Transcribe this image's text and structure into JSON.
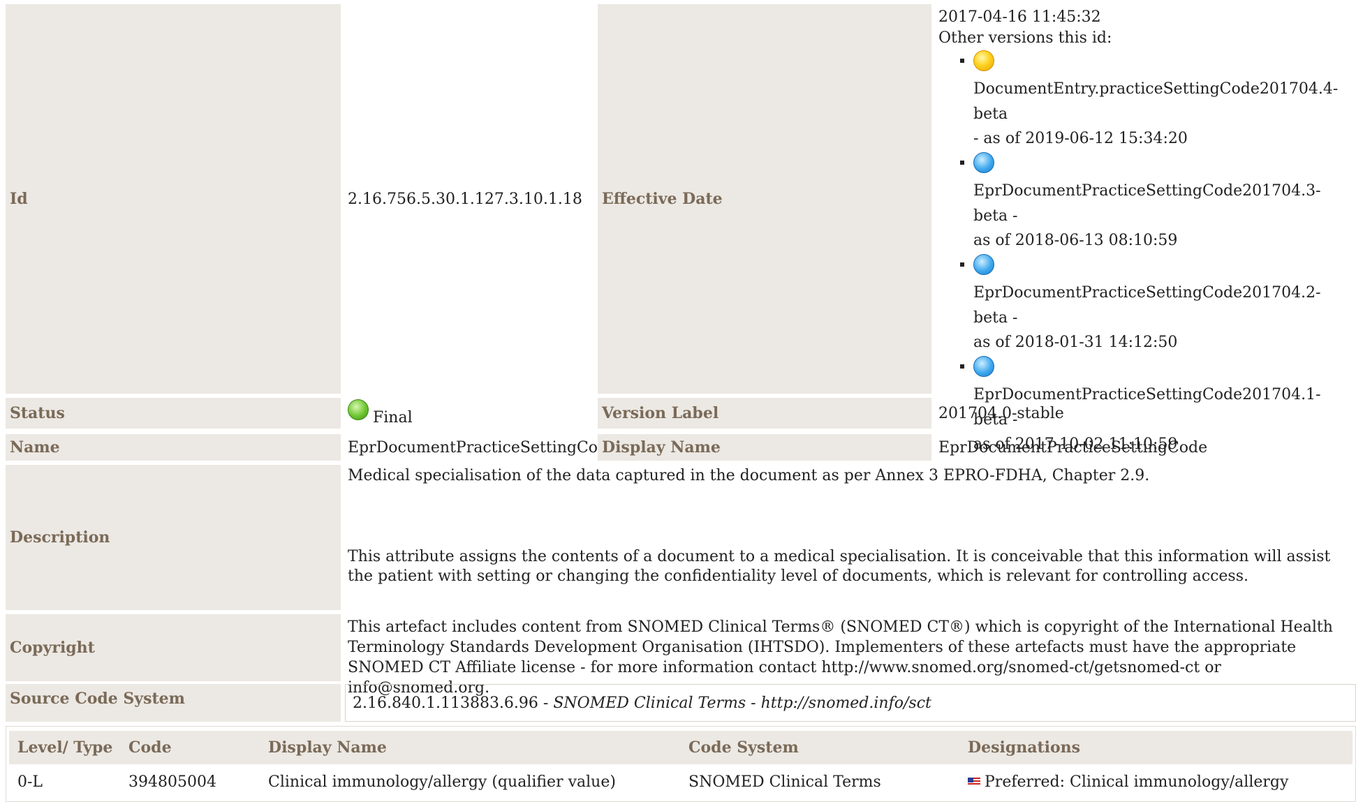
{
  "rows": {
    "id": {
      "label": "Id",
      "value": "2.16.756.5.30.1.127.3.10.1.18"
    },
    "effective_date": {
      "label": "Effective Date",
      "date": "2017-04-16 11:45:32",
      "other_versions_label": "Other versions this id:",
      "versions": [
        {
          "icon": "yellow-status-icon",
          "name": "DocumentEntry.practiceSettingCode201704.4-beta",
          "asof": "- as of 2019-06-12 15:34:20"
        },
        {
          "icon": "blue-status-icon",
          "name": "EprDocumentPracticeSettingCode201704.3-beta -",
          "asof": "as of 2018-06-13 08:10:59"
        },
        {
          "icon": "blue-status-icon",
          "name": "EprDocumentPracticeSettingCode201704.2-beta -",
          "asof": "as of 2018-01-31 14:12:50"
        },
        {
          "icon": "blue-status-icon",
          "name": "EprDocumentPracticeSettingCode201704.1-beta -",
          "asof": "as of 2017-10-02 11:10:59"
        }
      ]
    },
    "status": {
      "label": "Status",
      "value": "Final",
      "icon": "green-status-icon"
    },
    "version_label": {
      "label": "Version Label",
      "value": "201704.0-stable"
    },
    "name": {
      "label": "Name",
      "value": "EprDocumentPracticeSettingCode"
    },
    "display_name": {
      "label": "Display Name",
      "value": "EprDocumentPracticeSettingCode"
    },
    "description": {
      "label": "Description",
      "para1": "Medical specialisation of the data captured in the document as per Annex 3  EPRO-FDHA, Chapter 2.9.",
      "para2": "This attribute assigns the contents of a document to a medical specialisation. It is conceivable that this information will assist the patient with setting or changing the confidentiality level of documents, which is relevant for controlling access."
    },
    "copyright": {
      "label": "Copyright",
      "value": "This artefact includes content from SNOMED Clinical Terms® (SNOMED CT®) which is copyright of the International Health Terminology Standards Development Organisation (IHTSDO). Implementers of these artefacts must have the appropriate SNOMED CT Affiliate license - for more information contact http://www.snomed.org/snomed-ct/getsnomed-ct or info@snomed.org."
    },
    "source_code_system": {
      "label": "Source Code System",
      "oid": "2.16.840.1.113883.6.96 - ",
      "name": "SNOMED Clinical Terms - http://snomed.info/sct"
    }
  },
  "concept_table": {
    "headers": [
      "Level/ Type",
      "Code",
      "Display Name",
      "Code System",
      "Designations"
    ],
    "rows": [
      {
        "level": "0-L",
        "code": "394805004",
        "display": "Clinical immunology/allergy (qualifier value)",
        "system": "SNOMED Clinical Terms",
        "designation": "Preferred: Clinical immunology/allergy",
        "flag": "us-flag-icon"
      }
    ]
  }
}
